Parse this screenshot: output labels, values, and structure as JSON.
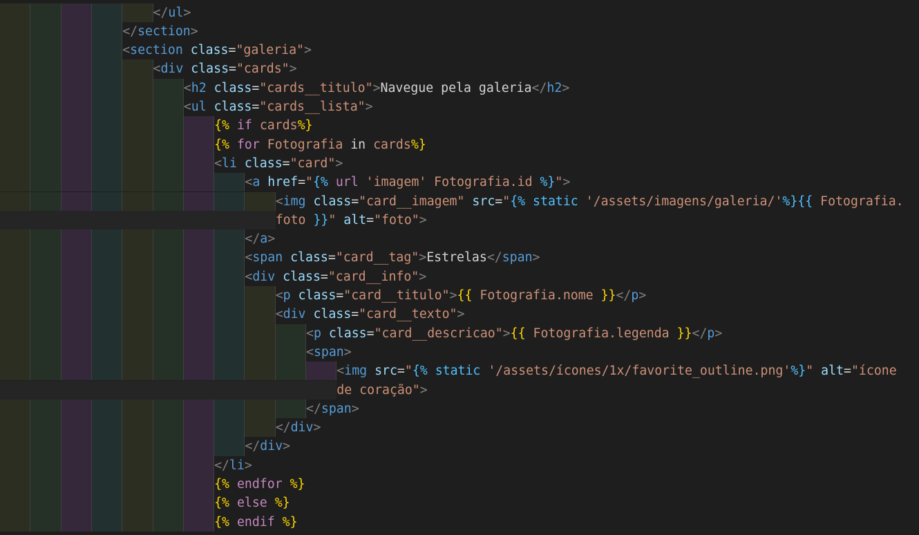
{
  "editor": {
    "indent_colors": [
      "#2d2e22",
      "#253026",
      "#34283a",
      "#22302f"
    ],
    "lines": [
      {
        "indent": 5,
        "tokens": [
          [
            "punct",
            "</"
          ],
          [
            "tag",
            "ul"
          ],
          [
            "punct",
            ">"
          ]
        ]
      },
      {
        "indent": 4,
        "tokens": [
          [
            "punct",
            "</"
          ],
          [
            "tag",
            "section"
          ],
          [
            "punct",
            ">"
          ]
        ]
      },
      {
        "indent": 4,
        "tokens": [
          [
            "punct",
            "<"
          ],
          [
            "tag",
            "section"
          ],
          [
            "text",
            " "
          ],
          [
            "attr",
            "class"
          ],
          [
            "eq",
            "="
          ],
          [
            "str",
            "\"galeria\""
          ],
          [
            "punct",
            ">"
          ]
        ]
      },
      {
        "indent": 5,
        "tokens": [
          [
            "punct",
            "<"
          ],
          [
            "tag",
            "div"
          ],
          [
            "text",
            " "
          ],
          [
            "attr",
            "class"
          ],
          [
            "eq",
            "="
          ],
          [
            "str",
            "\"cards\""
          ],
          [
            "punct",
            ">"
          ]
        ]
      },
      {
        "indent": 6,
        "tokens": [
          [
            "punct",
            "<"
          ],
          [
            "tag",
            "h2"
          ],
          [
            "text",
            " "
          ],
          [
            "attr",
            "class"
          ],
          [
            "eq",
            "="
          ],
          [
            "str",
            "\"cards__titulo\""
          ],
          [
            "punct",
            ">"
          ],
          [
            "text",
            "Navegue pela galeria"
          ],
          [
            "punct",
            "</"
          ],
          [
            "tag",
            "h2"
          ],
          [
            "punct",
            ">"
          ]
        ]
      },
      {
        "indent": 6,
        "tokens": [
          [
            "punct",
            "<"
          ],
          [
            "tag",
            "ul"
          ],
          [
            "text",
            " "
          ],
          [
            "attr",
            "class"
          ],
          [
            "eq",
            "="
          ],
          [
            "str",
            "\"cards__lista\""
          ],
          [
            "punct",
            ">"
          ]
        ]
      },
      {
        "indent": 7,
        "tokens": [
          [
            "brace",
            "{%"
          ],
          [
            "text",
            " "
          ],
          [
            "kw",
            "if"
          ],
          [
            "text",
            " "
          ],
          [
            "str",
            "cards"
          ],
          [
            "brace",
            "%}"
          ]
        ]
      },
      {
        "indent": 7,
        "tokens": [
          [
            "brace",
            "{%"
          ],
          [
            "text",
            " "
          ],
          [
            "kw",
            "for"
          ],
          [
            "text",
            " "
          ],
          [
            "str",
            "Fotografia"
          ],
          [
            "text",
            " in "
          ],
          [
            "str",
            "cards"
          ],
          [
            "brace",
            "%}"
          ]
        ]
      },
      {
        "indent": 7,
        "tokens": [
          [
            "punct",
            "<"
          ],
          [
            "tag",
            "li"
          ],
          [
            "text",
            " "
          ],
          [
            "attr",
            "class"
          ],
          [
            "eq",
            "="
          ],
          [
            "str",
            "\"card\""
          ],
          [
            "punct",
            ">"
          ]
        ]
      },
      {
        "indent": 8,
        "tokens": [
          [
            "punct",
            "<"
          ],
          [
            "tag",
            "a"
          ],
          [
            "text",
            " "
          ],
          [
            "attr",
            "href"
          ],
          [
            "eq",
            "="
          ],
          [
            "str",
            "\""
          ],
          [
            "jinja",
            "{%"
          ],
          [
            "str",
            " "
          ],
          [
            "kw",
            "url"
          ],
          [
            "str",
            " 'imagem' Fotografia.id "
          ],
          [
            "jinja",
            "%}"
          ],
          [
            "str",
            "\""
          ],
          [
            "punct",
            ">"
          ]
        ]
      },
      {
        "indent": 9,
        "tokens": [
          [
            "punct",
            "<"
          ],
          [
            "tag",
            "img"
          ],
          [
            "text",
            " "
          ],
          [
            "attr",
            "class"
          ],
          [
            "eq",
            "="
          ],
          [
            "str",
            "\"card__imagem\""
          ],
          [
            "text",
            " "
          ],
          [
            "attr",
            "src"
          ],
          [
            "eq",
            "="
          ],
          [
            "str",
            "\""
          ],
          [
            "jinja",
            "{%"
          ],
          [
            "str",
            " "
          ],
          [
            "jinja",
            "static"
          ],
          [
            "str",
            " '/assets/imagens/galeria/'"
          ],
          [
            "jinja",
            "%}{{"
          ],
          [
            "str",
            " Fotografia."
          ]
        ]
      },
      {
        "indent": 9,
        "wrap": true,
        "tokens": [
          [
            "str",
            "foto "
          ],
          [
            "jinja",
            "}}"
          ],
          [
            "str",
            "\""
          ],
          [
            "text",
            " "
          ],
          [
            "attr",
            "alt"
          ],
          [
            "eq",
            "="
          ],
          [
            "str",
            "\"foto\""
          ],
          [
            "punct",
            ">"
          ]
        ]
      },
      {
        "indent": 8,
        "tokens": [
          [
            "punct",
            "</"
          ],
          [
            "tag",
            "a"
          ],
          [
            "punct",
            ">"
          ]
        ]
      },
      {
        "indent": 8,
        "tokens": [
          [
            "punct",
            "<"
          ],
          [
            "tag",
            "span"
          ],
          [
            "text",
            " "
          ],
          [
            "attr",
            "class"
          ],
          [
            "eq",
            "="
          ],
          [
            "str",
            "\"card__tag\""
          ],
          [
            "punct",
            ">"
          ],
          [
            "text",
            "Estrelas"
          ],
          [
            "punct",
            "</"
          ],
          [
            "tag",
            "span"
          ],
          [
            "punct",
            ">"
          ]
        ]
      },
      {
        "indent": 8,
        "tokens": [
          [
            "punct",
            "<"
          ],
          [
            "tag",
            "div"
          ],
          [
            "text",
            " "
          ],
          [
            "attr",
            "class"
          ],
          [
            "eq",
            "="
          ],
          [
            "str",
            "\"card__info\""
          ],
          [
            "punct",
            ">"
          ]
        ]
      },
      {
        "indent": 9,
        "tokens": [
          [
            "punct",
            "<"
          ],
          [
            "tag",
            "p"
          ],
          [
            "text",
            " "
          ],
          [
            "attr",
            "class"
          ],
          [
            "eq",
            "="
          ],
          [
            "str",
            "\"card__titulo\""
          ],
          [
            "punct",
            ">"
          ],
          [
            "brace",
            "{{"
          ],
          [
            "text",
            " "
          ],
          [
            "str",
            "Fotografia.nome"
          ],
          [
            "text",
            " "
          ],
          [
            "brace",
            "}}"
          ],
          [
            "punct",
            "</"
          ],
          [
            "tag",
            "p"
          ],
          [
            "punct",
            ">"
          ]
        ]
      },
      {
        "indent": 9,
        "tokens": [
          [
            "punct",
            "<"
          ],
          [
            "tag",
            "div"
          ],
          [
            "text",
            " "
          ],
          [
            "attr",
            "class"
          ],
          [
            "eq",
            "="
          ],
          [
            "str",
            "\"card__texto\""
          ],
          [
            "punct",
            ">"
          ]
        ]
      },
      {
        "indent": 10,
        "tokens": [
          [
            "punct",
            "<"
          ],
          [
            "tag",
            "p"
          ],
          [
            "text",
            " "
          ],
          [
            "attr",
            "class"
          ],
          [
            "eq",
            "="
          ],
          [
            "str",
            "\"card__descricao\""
          ],
          [
            "punct",
            ">"
          ],
          [
            "brace",
            "{{"
          ],
          [
            "text",
            " "
          ],
          [
            "str",
            "Fotografia.legenda"
          ],
          [
            "text",
            " "
          ],
          [
            "brace",
            "}}"
          ],
          [
            "punct",
            "</"
          ],
          [
            "tag",
            "p"
          ],
          [
            "punct",
            ">"
          ]
        ]
      },
      {
        "indent": 10,
        "tokens": [
          [
            "punct",
            "<"
          ],
          [
            "tag",
            "span"
          ],
          [
            "punct",
            ">"
          ]
        ]
      },
      {
        "indent": 11,
        "tokens": [
          [
            "punct",
            "<"
          ],
          [
            "tag",
            "img"
          ],
          [
            "text",
            " "
          ],
          [
            "attr",
            "src"
          ],
          [
            "eq",
            "="
          ],
          [
            "str",
            "\""
          ],
          [
            "jinja",
            "{%"
          ],
          [
            "str",
            " "
          ],
          [
            "jinja",
            "static"
          ],
          [
            "str",
            " '/assets/ícones/1x/favorite_outline.png'"
          ],
          [
            "jinja",
            "%}"
          ],
          [
            "str",
            "\""
          ],
          [
            "text",
            " "
          ],
          [
            "attr",
            "alt"
          ],
          [
            "eq",
            "="
          ],
          [
            "str",
            "\"ícone"
          ]
        ]
      },
      {
        "indent": 11,
        "wrap": true,
        "tokens": [
          [
            "str",
            "de coração\""
          ],
          [
            "punct",
            ">"
          ]
        ]
      },
      {
        "indent": 10,
        "tokens": [
          [
            "punct",
            "</"
          ],
          [
            "tag",
            "span"
          ],
          [
            "punct",
            ">"
          ]
        ]
      },
      {
        "indent": 9,
        "tokens": [
          [
            "punct",
            "</"
          ],
          [
            "tag",
            "div"
          ],
          [
            "punct",
            ">"
          ]
        ]
      },
      {
        "indent": 8,
        "tokens": [
          [
            "punct",
            "</"
          ],
          [
            "tag",
            "div"
          ],
          [
            "punct",
            ">"
          ]
        ]
      },
      {
        "indent": 7,
        "tokens": [
          [
            "punct",
            "</"
          ],
          [
            "tag",
            "li"
          ],
          [
            "punct",
            ">"
          ]
        ]
      },
      {
        "indent": 7,
        "tokens": [
          [
            "brace",
            "{%"
          ],
          [
            "text",
            " "
          ],
          [
            "kw",
            "endfor"
          ],
          [
            "text",
            " "
          ],
          [
            "brace",
            "%}"
          ]
        ]
      },
      {
        "indent": 7,
        "tokens": [
          [
            "brace",
            "{%"
          ],
          [
            "text",
            " "
          ],
          [
            "kw",
            "else"
          ],
          [
            "text",
            " "
          ],
          [
            "brace",
            "%}"
          ]
        ]
      },
      {
        "indent": 7,
        "tokens": [
          [
            "brace",
            "{%"
          ],
          [
            "text",
            " "
          ],
          [
            "kw",
            "endif"
          ],
          [
            "text",
            " "
          ],
          [
            "brace",
            "%}"
          ]
        ]
      }
    ]
  }
}
